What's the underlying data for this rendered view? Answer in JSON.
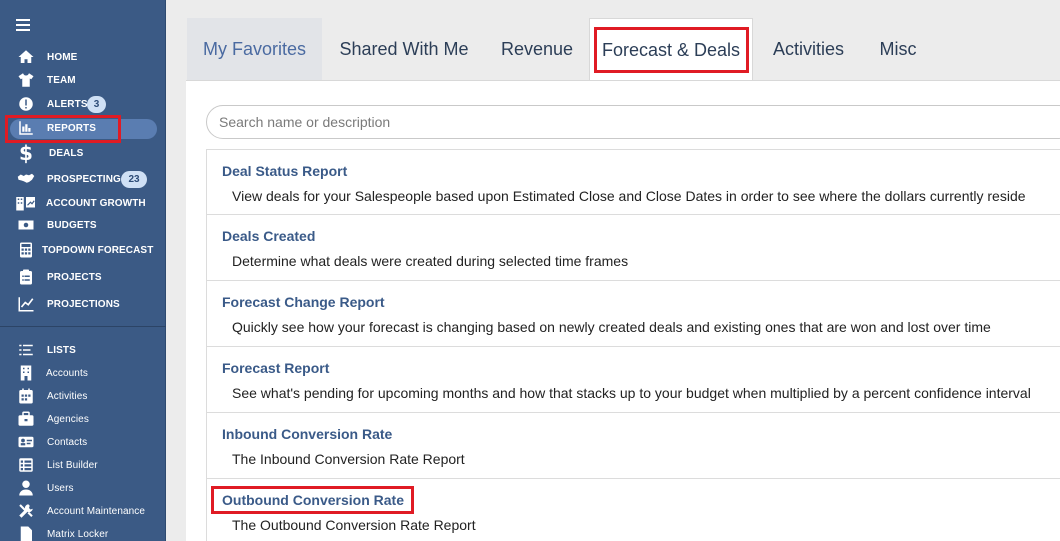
{
  "sidebar": {
    "items": [
      {
        "label": "HOME",
        "icon": "home-icon"
      },
      {
        "label": "TEAM",
        "icon": "shirt-icon"
      },
      {
        "label": "ALERTS",
        "icon": "alert-icon",
        "badge": "3"
      },
      {
        "label": "REPORTS",
        "icon": "chart-icon"
      },
      {
        "label": "DEALS",
        "icon": "dollar-icon"
      },
      {
        "label": "PROSPECTING",
        "icon": "handshake-icon",
        "badge": "23"
      },
      {
        "label": "ACCOUNT GROWTH",
        "icon": "building-growth-icon"
      },
      {
        "label": "BUDGETS",
        "icon": "money-icon"
      },
      {
        "label": "TOPDOWN FORECAST",
        "icon": "calculator-icon"
      },
      {
        "label": "PROJECTS",
        "icon": "clipboard-icon"
      },
      {
        "label": "PROJECTIONS",
        "icon": "line-chart-icon"
      }
    ],
    "lower_items": [
      {
        "label": "LISTS",
        "icon": "list-icon"
      },
      {
        "label": "Accounts",
        "icon": "building-icon"
      },
      {
        "label": "Activities",
        "icon": "calendar-icon"
      },
      {
        "label": "Agencies",
        "icon": "briefcase-icon"
      },
      {
        "label": "Contacts",
        "icon": "contact-card-icon"
      },
      {
        "label": "List Builder",
        "icon": "table-list-icon"
      },
      {
        "label": "Users",
        "icon": "user-icon"
      },
      {
        "label": "Account Maintenance",
        "icon": "tools-icon"
      },
      {
        "label": "Matrix Locker",
        "icon": "file-icon"
      }
    ]
  },
  "tabs": [
    {
      "label": "My Favorites"
    },
    {
      "label": "Shared With Me"
    },
    {
      "label": "Revenue"
    },
    {
      "label": "Forecast & Deals"
    },
    {
      "label": "Activities"
    },
    {
      "label": "Misc"
    }
  ],
  "search": {
    "placeholder": "Search name or description",
    "value": ""
  },
  "reports": [
    {
      "title": "Deal Status Report",
      "description": "View deals for your Salespeople based upon Estimated Close and Close Dates in order to see where the dollars currently reside"
    },
    {
      "title": "Deals Created",
      "description": "Determine what deals were created during selected time frames"
    },
    {
      "title": "Forecast Change Report",
      "description": "Quickly see how your forecast is changing based on newly created deals and existing ones that are won and lost over time"
    },
    {
      "title": "Forecast Report",
      "description": "See what's pending for upcoming months and how that stacks up to your budget when multiplied by a percent confidence interval"
    },
    {
      "title": "Inbound Conversion Rate",
      "description": "The Inbound Conversion Rate Report"
    },
    {
      "title": "Outbound Conversion Rate",
      "description": "The Outbound Conversion Rate Report"
    }
  ],
  "colors": {
    "sidebar_bg": "#3b5a85",
    "active_pill": "#5a7db1",
    "highlight": "#e01b24",
    "link": "#3a5a88"
  }
}
